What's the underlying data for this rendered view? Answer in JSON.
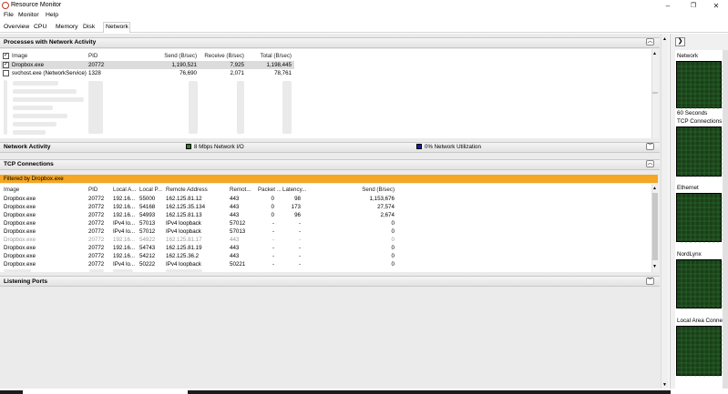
{
  "window": {
    "title": "Resource Monitor",
    "minimize": "–",
    "maximize": "❐",
    "close": "✕"
  },
  "menu": [
    "File",
    "Monitor",
    "Help"
  ],
  "tabs": [
    "Overview",
    "CPU",
    "Memory",
    "Disk",
    "Network"
  ],
  "processes": {
    "title": "Processes with Network Activity",
    "columns": [
      "Image",
      "PID",
      "Send (B/sec)",
      "Receive (B/sec)",
      "Total (B/sec)"
    ],
    "rows": [
      {
        "image": "Dropbox.exe",
        "pid": "20772",
        "send": "1,190,521",
        "receive": "7,925",
        "total": "1,198,445",
        "checked": true
      },
      {
        "image": "svchost.exe (NetworkService)",
        "pid": "1328",
        "send": "76,690",
        "receive": "2,071",
        "total": "78,761",
        "checked": false
      }
    ]
  },
  "network_activity": {
    "title": "Network Activity",
    "io_label": "8 Mbps Network I/O",
    "util_label": "0% Network Utilization",
    "io_color": "#1e8a1e",
    "util_color": "#1a1aa6"
  },
  "tcp": {
    "title": "TCP Connections",
    "filter": "Filtered by Dropbox.exe",
    "columns": [
      "Image",
      "PID",
      "Local A...",
      "Local P...",
      "Remote Address",
      "Remot...",
      "Packet ...",
      "Latency...",
      "Send (B/sec)"
    ],
    "rows": [
      {
        "image": "Dropbox.exe",
        "pid": "20772",
        "laddr": "192.16...",
        "lport": "55000",
        "raddr": "162.125.81.12",
        "rport": "443",
        "loss": "0",
        "lat": "98",
        "send": "1,153,676",
        "dim": false
      },
      {
        "image": "Dropbox.exe",
        "pid": "20772",
        "laddr": "192.16...",
        "lport": "54168",
        "raddr": "162.125.35.134",
        "rport": "443",
        "loss": "0",
        "lat": "173",
        "send": "27,574",
        "dim": false
      },
      {
        "image": "Dropbox.exe",
        "pid": "20772",
        "laddr": "192.16...",
        "lport": "54993",
        "raddr": "162.125.81.13",
        "rport": "443",
        "loss": "0",
        "lat": "96",
        "send": "2,674",
        "dim": false
      },
      {
        "image": "Dropbox.exe",
        "pid": "20772",
        "laddr": "IPv4 lo...",
        "lport": "57013",
        "raddr": "IPv4 loopback",
        "rport": "57012",
        "loss": "-",
        "lat": "-",
        "send": "0",
        "dim": false
      },
      {
        "image": "Dropbox.exe",
        "pid": "20772",
        "laddr": "IPv4 lo...",
        "lport": "57012",
        "raddr": "IPv4 loopback",
        "rport": "57013",
        "loss": "-",
        "lat": "-",
        "send": "0",
        "dim": false
      },
      {
        "image": "Dropbox.exe",
        "pid": "20772",
        "laddr": "192.16...",
        "lport": "54922",
        "raddr": "162.125.81.17",
        "rport": "443",
        "loss": "-",
        "lat": "-",
        "send": "0",
        "dim": true
      },
      {
        "image": "Dropbox.exe",
        "pid": "20772",
        "laddr": "192.16...",
        "lport": "54743",
        "raddr": "162.125.81.19",
        "rport": "443",
        "loss": "-",
        "lat": "-",
        "send": "0",
        "dim": false
      },
      {
        "image": "Dropbox.exe",
        "pid": "20772",
        "laddr": "192.16...",
        "lport": "54212",
        "raddr": "162.125.36.2",
        "rport": "443",
        "loss": "-",
        "lat": "-",
        "send": "0",
        "dim": false
      },
      {
        "image": "Dropbox.exe",
        "pid": "20772",
        "laddr": "IPv4 lo...",
        "lport": "50222",
        "raddr": "IPv4 loopback",
        "rport": "50221",
        "loss": "-",
        "lat": "-",
        "send": "0",
        "dim": false
      }
    ]
  },
  "listening": {
    "title": "Listening Ports"
  },
  "right_panel": {
    "expand": "❯",
    "graphs": [
      {
        "title": "Network",
        "footer": "60 Seconds"
      },
      {
        "title": "TCP Connections",
        "footer": ""
      },
      {
        "title": "Ethernet",
        "footer": ""
      },
      {
        "title": "NordLynx",
        "footer": ""
      },
      {
        "title": "Local Area Conne",
        "footer": ""
      }
    ]
  }
}
